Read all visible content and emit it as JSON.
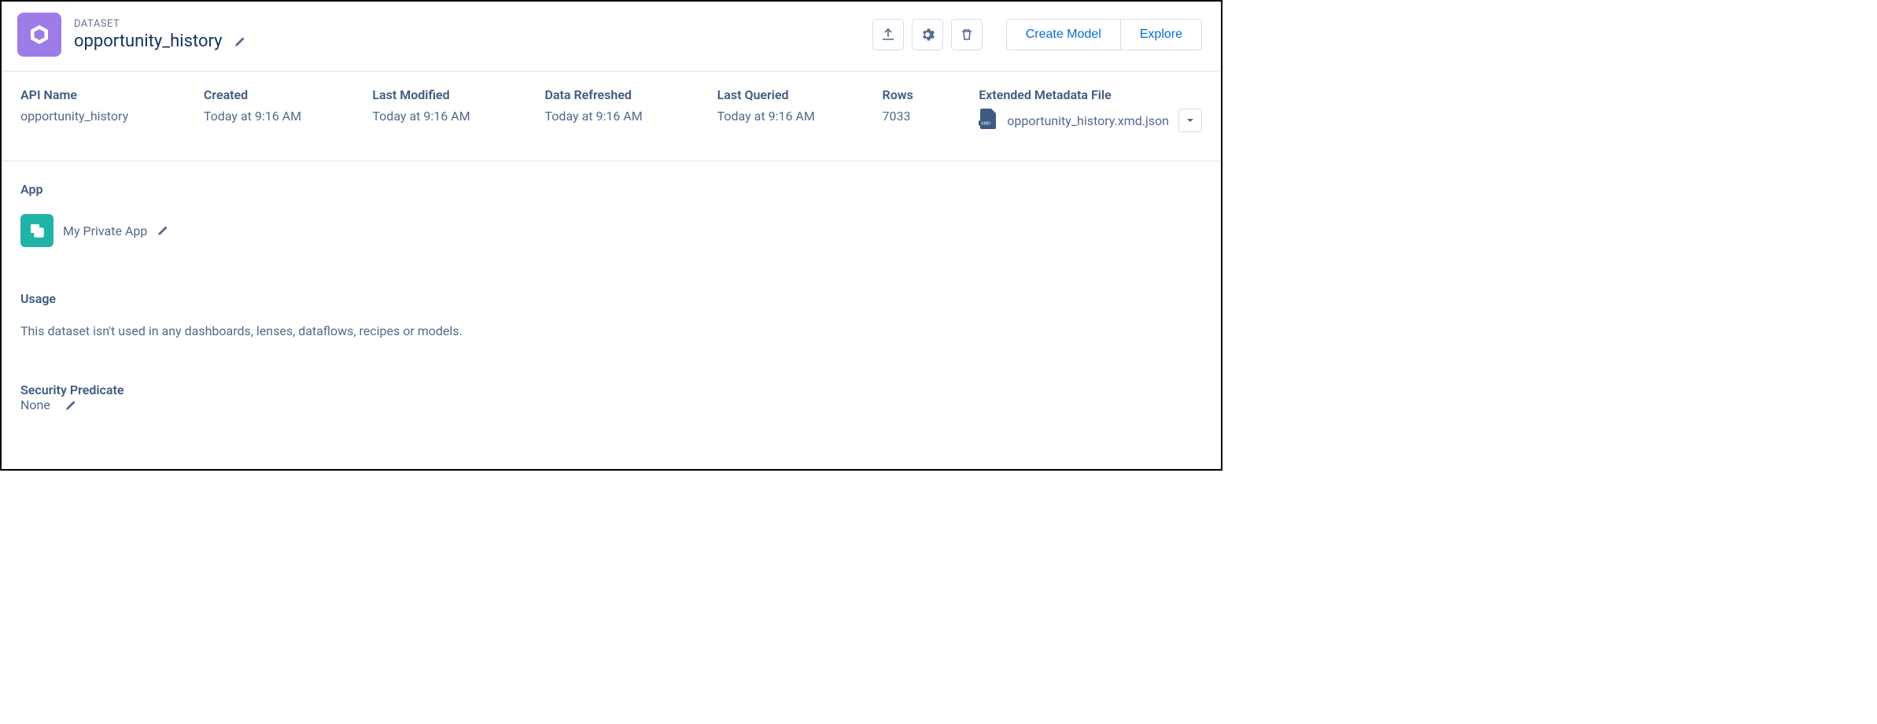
{
  "header": {
    "type_label": "DATASET",
    "title": "opportunity_history",
    "actions": {
      "create_model": "Create Model",
      "explore": "Explore"
    }
  },
  "meta": {
    "api_name_label": "API Name",
    "api_name_value": "opportunity_history",
    "created_label": "Created",
    "created_value": "Today at 9:16 AM",
    "modified_label": "Last Modified",
    "modified_value": "Today at 9:16 AM",
    "refreshed_label": "Data Refreshed",
    "refreshed_value": "Today at 9:16 AM",
    "queried_label": "Last Queried",
    "queried_value": "Today at 9:16 AM",
    "rows_label": "Rows",
    "rows_value": "7033",
    "xmd_label": "Extended Metadata File",
    "xmd_filename": "opportunity_history.xmd.json"
  },
  "sections": {
    "app": {
      "title": "App",
      "name": "My Private App"
    },
    "usage": {
      "title": "Usage",
      "text": "This dataset isn't used in any dashboards, lenses, dataflows, recipes or models."
    },
    "security": {
      "title": "Security Predicate",
      "value": "None"
    }
  }
}
